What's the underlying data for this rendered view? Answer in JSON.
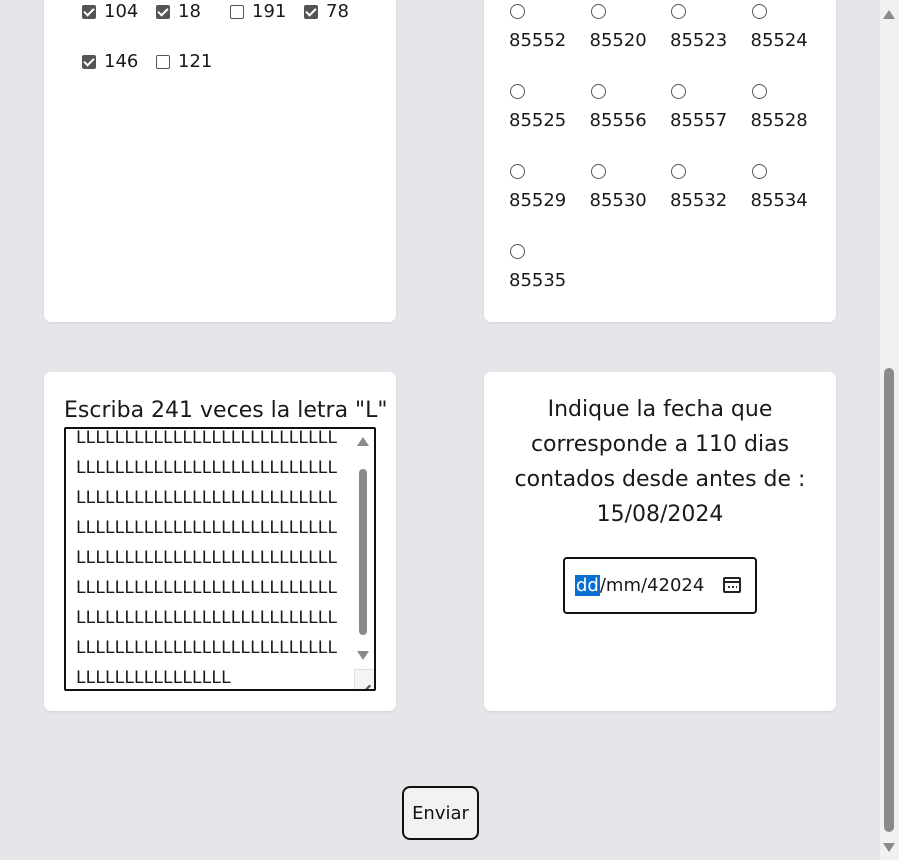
{
  "checkbox_group": {
    "items": [
      {
        "label": "104",
        "checked": true
      },
      {
        "label": "18",
        "checked": true
      },
      {
        "label": "191",
        "checked": false
      },
      {
        "label": "78",
        "checked": true
      },
      {
        "label": "146",
        "checked": true
      },
      {
        "label": "121",
        "checked": false
      }
    ]
  },
  "radio_group": {
    "items": [
      {
        "label": "85552"
      },
      {
        "label": "85520"
      },
      {
        "label": "85523"
      },
      {
        "label": "85524"
      },
      {
        "label": "85525"
      },
      {
        "label": "85556"
      },
      {
        "label": "85557"
      },
      {
        "label": "85528"
      },
      {
        "label": "85529"
      },
      {
        "label": "85530"
      },
      {
        "label": "85532"
      },
      {
        "label": "85534"
      },
      {
        "label": "85535"
      }
    ]
  },
  "text_question": {
    "prompt": "Escriba 241 veces la letra \"L\"",
    "lines": [
      "LLLLLLLLLLLLLLLLLLLLLLLLLLL",
      "LLLLLLLLLLLLLLLLLLLLLLLLLLL",
      "LLLLLLLLLLLLLLLLLLLLLLLLLLL",
      "LLLLLLLLLLLLLLLLLLLLLLLLLLL",
      "LLLLLLLLLLLLLLLLLLLLLLLLLLL",
      "LLLLLLLLLLLLLLLLLLLLLLLLLLL",
      "LLLLLLLLLLLLLLLLLLLLLLLLLLL",
      "LLLLLLLLLLLLLLLLLLLLLLLLLLL",
      "LLLLLLLLLLLLLLLL"
    ]
  },
  "date_question": {
    "prompt": "Indique la fecha que corresponde a 110 dias contados desde antes de : 15/08/2024",
    "day_placeholder": "dd",
    "rest_value": "/mm/42024"
  },
  "submit": {
    "label": "Enviar"
  }
}
